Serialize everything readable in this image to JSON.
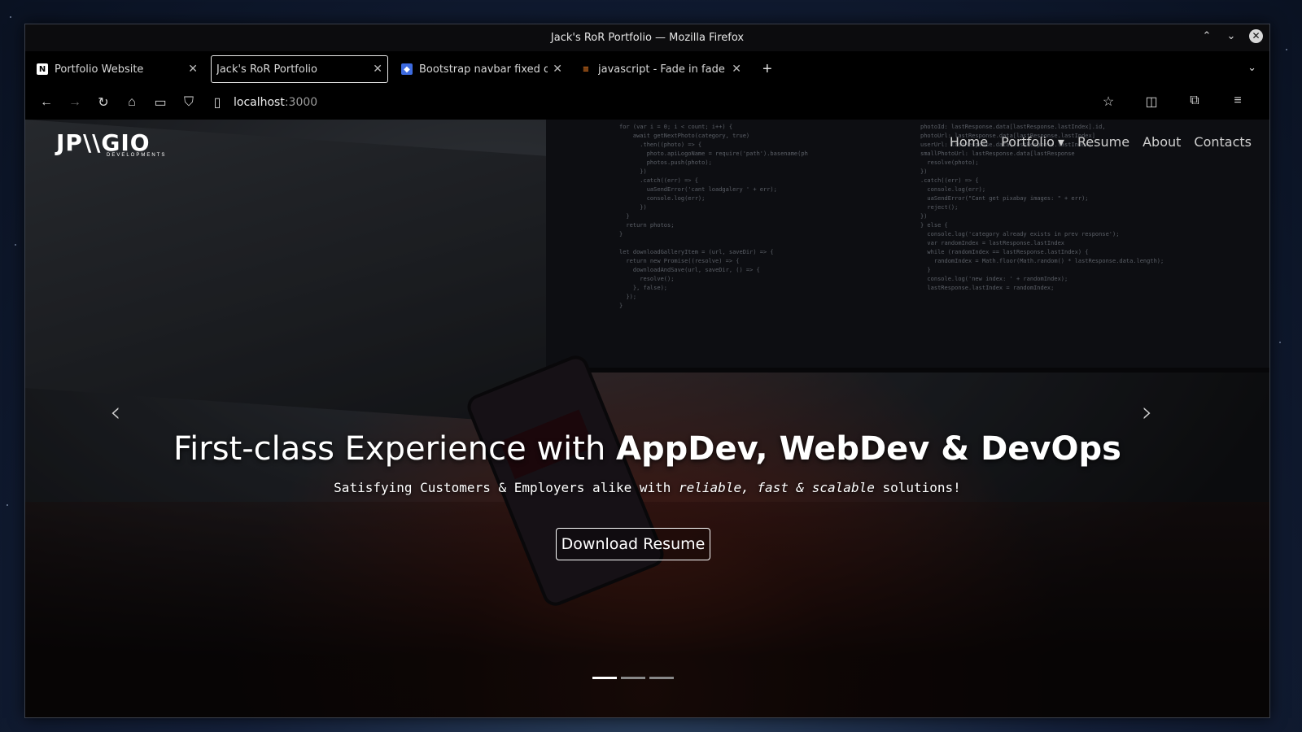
{
  "window": {
    "title": "Jack's RoR Portfolio — Mozilla Firefox",
    "controls": {
      "minimize": "⌃",
      "maximize": "⌄",
      "close": "✕"
    }
  },
  "tabs": [
    {
      "label": "Portfolio Website",
      "icon": "notion-icon",
      "active": false
    },
    {
      "label": "Jack's RoR Portfolio",
      "icon": "none",
      "active": true
    },
    {
      "label": "Bootstrap navbar fixed on",
      "icon": "bootstrap-icon",
      "active": false
    },
    {
      "label": "javascript - Fade in fade ou",
      "icon": "stackoverflow-icon",
      "active": false
    }
  ],
  "toolbar": {
    "new_tab": "+",
    "tab_list": "⌄",
    "url_host": "localhost",
    "url_port": ":3000"
  },
  "site": {
    "brand": "JP\\\\GIO",
    "brand_sub": "DEVELOPMENTS",
    "nav": {
      "home": "Home",
      "portfolio": "Portfolio",
      "resume": "Resume",
      "about": "About",
      "contacts": "Contacts"
    }
  },
  "hero": {
    "title_plain": "First-class Experience with ",
    "title_bold": "AppDev, WebDev & DevOps",
    "sub_start": "Satisfying Customers & Employers alike with ",
    "sub_italic": "reliable, fast & scalable",
    "sub_end": " solutions!",
    "button": "Download Resume"
  },
  "carousel": {
    "prev": "‹",
    "next": "›",
    "slides": 3,
    "active_slide": 1
  },
  "colors": {
    "accent": "#ffffff",
    "chrome_bg": "#000000",
    "warm_glow": "#c84628"
  }
}
